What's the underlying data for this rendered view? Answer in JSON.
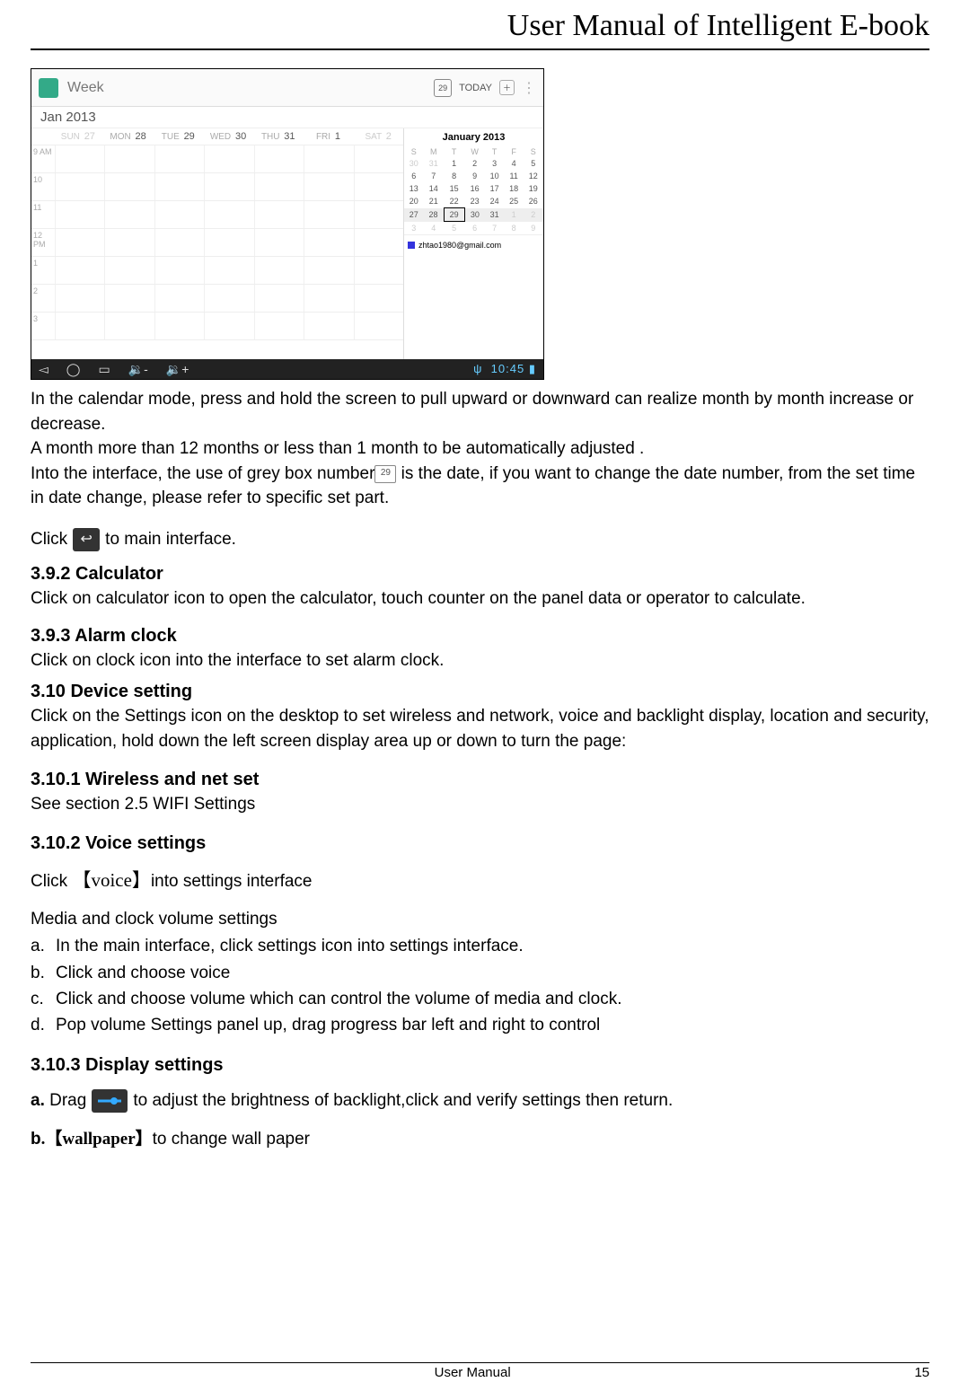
{
  "header": {
    "title": "User Manual of Intelligent E-book"
  },
  "screenshot": {
    "top": {
      "view_label": "Week",
      "today_num": "29",
      "today_label": "TODAY"
    },
    "subbar": "Jan 2013",
    "days": [
      {
        "dow": "SUN",
        "num": "27",
        "gray": true
      },
      {
        "dow": "MON",
        "num": "28"
      },
      {
        "dow": "TUE",
        "num": "29"
      },
      {
        "dow": "WED",
        "num": "30"
      },
      {
        "dow": "THU",
        "num": "31"
      },
      {
        "dow": "FRI",
        "num": "1"
      },
      {
        "dow": "SAT",
        "num": "2",
        "gray": true
      }
    ],
    "hours": [
      "9 AM",
      "10",
      "11",
      "12 PM",
      "1",
      "2",
      "3"
    ],
    "minical": {
      "title": "January 2013",
      "dow": [
        "S",
        "M",
        "T",
        "W",
        "T",
        "F",
        "S"
      ],
      "rows": [
        [
          "30",
          "31",
          "1",
          "2",
          "3",
          "4",
          "5"
        ],
        [
          "6",
          "7",
          "8",
          "9",
          "10",
          "11",
          "12"
        ],
        [
          "13",
          "14",
          "15",
          "16",
          "17",
          "18",
          "19"
        ],
        [
          "20",
          "21",
          "22",
          "23",
          "24",
          "25",
          "26"
        ],
        [
          "27",
          "28",
          "29",
          "30",
          "31",
          "1",
          "2"
        ],
        [
          "3",
          "4",
          "5",
          "6",
          "7",
          "8",
          "9"
        ]
      ]
    },
    "account": "zhtao1980@gmail.com",
    "clock": "10:45"
  },
  "paragraphs": {
    "p1": "In the calendar mode, press and hold the screen to pull upward or downward can realize month by month increase or decrease.",
    "p2": "A month more than 12 months or less than 1 month to be automatically adjusted .",
    "p3a": "Into the interface, the use of grey box number",
    "p3b": " is the date, if you want to change the date number, from the set time in date change, please refer to specific set part.",
    "click_a": "Click ",
    "click_b": " to main interface."
  },
  "sections": {
    "calc_h": "3.9.2 Calculator",
    "calc_t": "Click on calculator icon to open the calculator, touch counter on the panel data or operator to calculate.",
    "alarm_h": "3.9.3 Alarm clock",
    "alarm_t": "Click on clock icon into the interface to set alarm clock.",
    "dev_h": "3.10 Device setting",
    "dev_t": "Click on the Settings icon on the desktop to set wireless and network, voice and backlight display, location and security, application, hold down the left screen display area up or down to turn the page:",
    "wifi_h": "3.10.1 Wireless and net set",
    "wifi_t": "See section 2.5 WIFI Settings",
    "voice_h": "3.10.2 Voice settings",
    "voice_click_a": "Click ",
    "voice_click_b": "【voice】",
    "voice_click_c": "into settings interface",
    "voice_sub": "Media and clock volume settings",
    "voice_list": {
      "a": "In the main interface, click settings icon into settings interface.",
      "b": "Click and choose voice",
      "c": "Click and choose volume which can control the volume of media and clock.",
      "d": "Pop volume Settings panel up, drag progress bar left and right to control"
    },
    "disp_h": "3.10.3 Display settings",
    "disp_a_lbl": "a.",
    "disp_a1": " Drag ",
    "disp_a2": " to adjust the brightness of backlight,click and verify settings then return.",
    "disp_b_lbl": "b",
    "disp_b_bold": ".【wallpaper】",
    "disp_b_rest": "to change wall paper"
  },
  "footer": {
    "center": "User Manual",
    "page": "15"
  }
}
